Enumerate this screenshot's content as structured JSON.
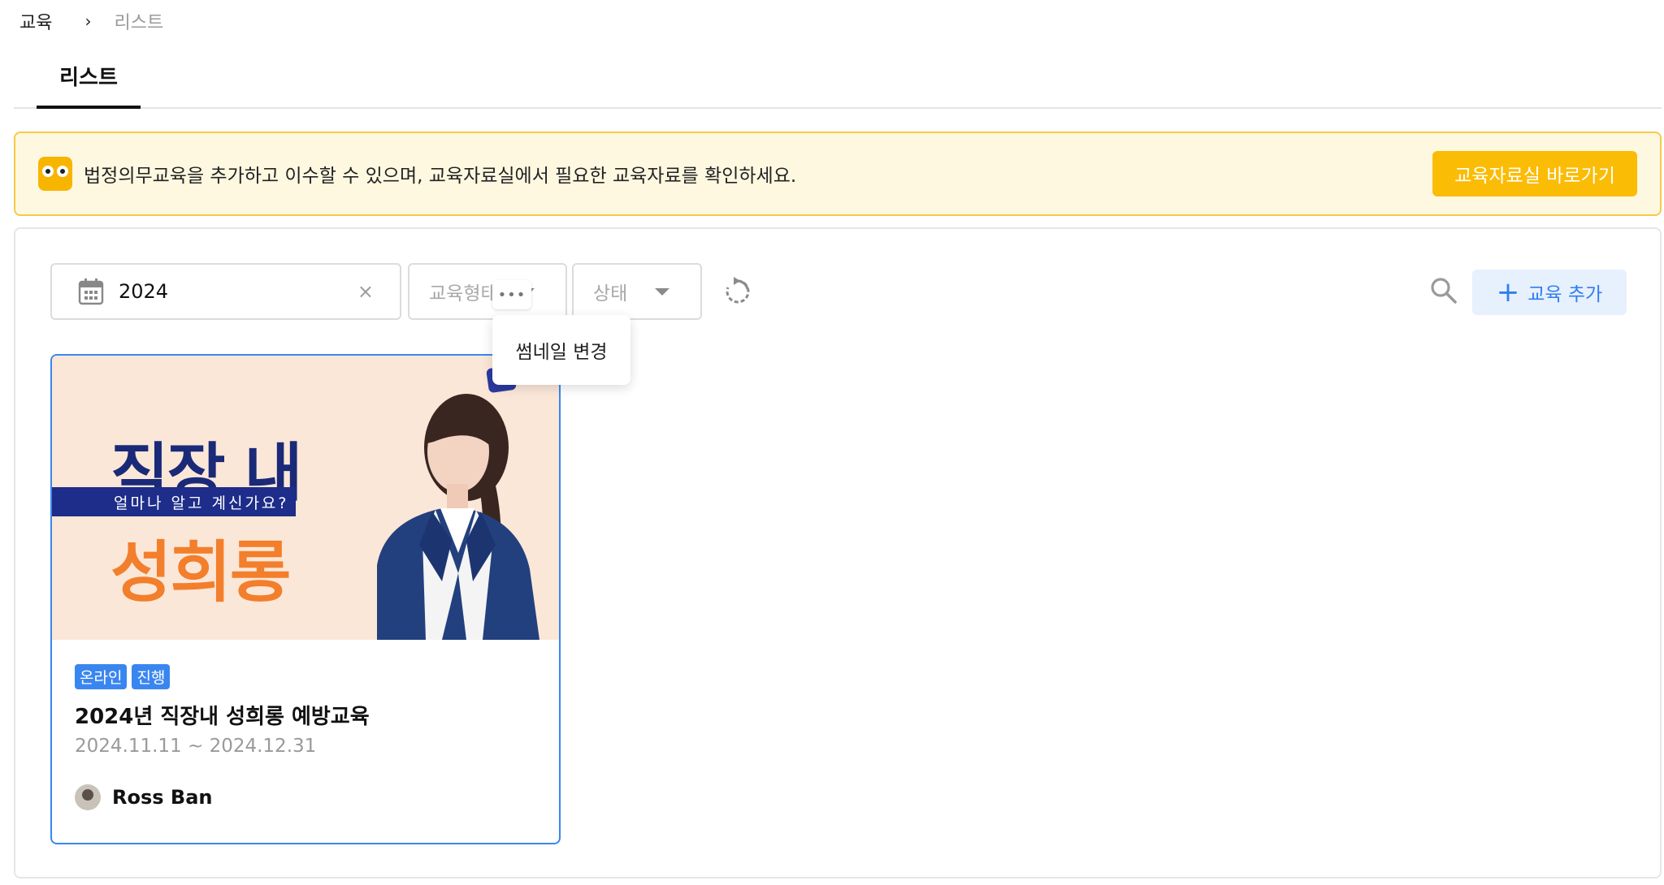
{
  "breadcrumb": {
    "root": "교육",
    "separator": "›",
    "current": "리스트"
  },
  "tabs": [
    {
      "label": "리스트",
      "active": true
    }
  ],
  "notice": {
    "text": "법정의무교육을 추가하고 이수할 수 있으며, 교육자료실에서 필요한 교육자료를 확인하세요.",
    "button": "교육자료실 바로가기"
  },
  "filters": {
    "year": "2024",
    "clear_icon": "×",
    "type_placeholder": "교육형태",
    "status_placeholder": "상태"
  },
  "toolbar": {
    "add_label": "교육 추가",
    "add_icon": "+"
  },
  "card": {
    "thumbnail": {
      "line1": "직장 내",
      "band": "얼마나 알고 계신가요?",
      "line2": "성희롱"
    },
    "more_icon": "•••",
    "menu": [
      "썸네일 변경"
    ],
    "tags": [
      "온라인",
      "진행"
    ],
    "title": "2024년 직장내 성희롱 예방교육",
    "period": "2024.11.11 ~ 2024.12.31",
    "owner": "Ross Ban"
  },
  "colors": {
    "accent": "#3a86f0",
    "notice_bg": "#fff8e1",
    "notice_button": "#fbbc05"
  }
}
